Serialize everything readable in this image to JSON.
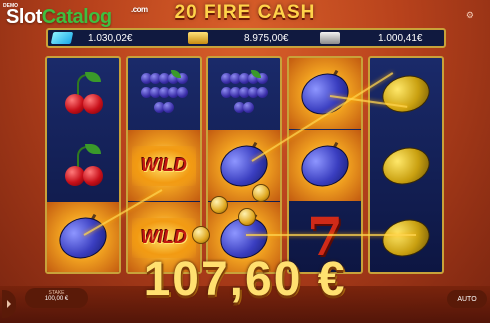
{
  "header": {
    "demo_label": "DEMO",
    "watermark": {
      "part1": "Slot",
      "part2": "Catalog",
      "suffix": ".com"
    },
    "game_title": "20 FIRE CASH",
    "settings_glyph": "⚙"
  },
  "jackpots": [
    {
      "icon": "diamond-icon",
      "value": "1.030,02€"
    },
    {
      "icon": "gold-bars-icon",
      "value": "8.975,00€"
    },
    {
      "icon": "silver-bars-icon",
      "value": "1.000,41€"
    }
  ],
  "reels": [
    {
      "symbols": [
        "cherry",
        "cherry",
        "plum"
      ],
      "winning": [
        false,
        false,
        true
      ]
    },
    {
      "symbols": [
        "grape",
        "wild",
        "wild"
      ],
      "winning": [
        false,
        true,
        true
      ]
    },
    {
      "symbols": [
        "grape",
        "plum",
        "plum"
      ],
      "winning": [
        false,
        true,
        true
      ]
    },
    {
      "symbols": [
        "plum",
        "plum",
        "seven"
      ],
      "winning": [
        true,
        true,
        false
      ]
    },
    {
      "symbols": [
        "lemon",
        "lemon",
        "lemon"
      ],
      "winning": [
        false,
        false,
        false
      ]
    }
  ],
  "win_amount": "107,60 €",
  "bottom": {
    "stake_label": "STAKE",
    "stake_value": "100,00 €",
    "auto_label": "AUTO"
  },
  "colors": {
    "accent_gold": "#ffd34a",
    "reel_frame": "#c8a23a",
    "background": "#b8421c"
  }
}
